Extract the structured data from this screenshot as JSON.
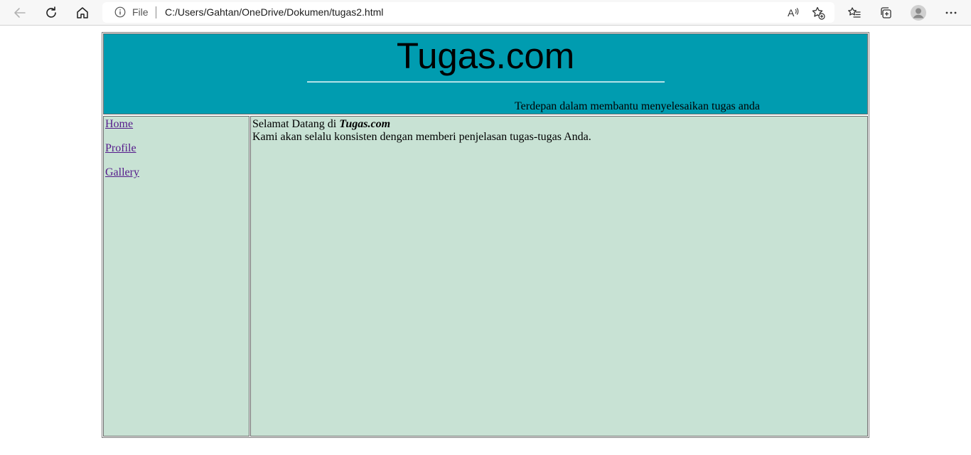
{
  "browser": {
    "address_scheme": "File",
    "address_url": "C:/Users/Gahtan/OneDrive/Dokumen/tugas2.html",
    "read_aloud_label": "A",
    "icons": [
      "back-icon",
      "refresh-icon",
      "home-icon",
      "info-icon",
      "read-aloud-icon",
      "add-favorite-icon",
      "favorites-icon",
      "collections-icon",
      "profile-avatar-icon",
      "more-icon"
    ]
  },
  "header": {
    "title": "Tugas.com",
    "tagline": "Terdepan dalam membantu menyelesaikan tugas anda",
    "background": "#009cb0"
  },
  "sidebar": {
    "links": [
      {
        "label": "Home"
      },
      {
        "label": "Profile"
      },
      {
        "label": "Gallery"
      }
    ],
    "background": "#c8e2d4"
  },
  "content": {
    "welcome_prefix": "Selamat Datang di",
    "welcome_brand": "Tugas.com",
    "message": "Kami akan selalu konsisten dengan memberi penjelasan tugas-tugas Anda.",
    "background": "#c8e2d4"
  },
  "colors": {
    "link": "#551a8b",
    "border": "#6b6b6b"
  }
}
